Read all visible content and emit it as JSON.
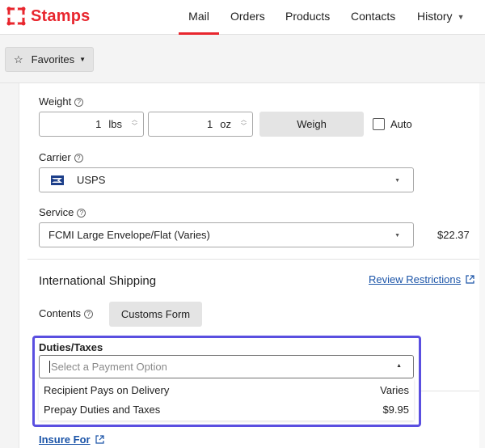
{
  "app": {
    "name": "Stamps",
    "brand_color": "#e8262e"
  },
  "nav": {
    "items": [
      {
        "label": "Mail",
        "active": true
      },
      {
        "label": "Orders",
        "active": false
      },
      {
        "label": "Products",
        "active": false
      },
      {
        "label": "Contacts",
        "active": false
      },
      {
        "label": "History",
        "active": false
      }
    ]
  },
  "favorites": {
    "label": "Favorites",
    "icon": "star-icon"
  },
  "weight": {
    "label": "Weight",
    "lbs_value": "1",
    "lbs_unit": "lbs",
    "oz_value": "1",
    "oz_unit": "oz",
    "weigh_button": "Weigh",
    "auto_label": "Auto",
    "auto_checked": false
  },
  "carrier": {
    "label": "Carrier",
    "value": "USPS",
    "icon": "usps-eagle-icon"
  },
  "service": {
    "label": "Service",
    "value": "FCMI Large Envelope/Flat (Varies)",
    "price": "$22.37"
  },
  "international": {
    "title": "International Shipping",
    "review_link": "Review Restrictions",
    "contents_label": "Contents",
    "customs_button": "Customs Form"
  },
  "duties": {
    "label": "Duties/Taxes",
    "placeholder": "Select a Payment Option",
    "focus_color": "#5a4fe0",
    "options": [
      {
        "label": "Recipient Pays on Delivery",
        "value": "Varies"
      },
      {
        "label": "Prepay Duties and Taxes",
        "value": "$9.95"
      }
    ]
  },
  "insure": {
    "label": "Insure For"
  }
}
